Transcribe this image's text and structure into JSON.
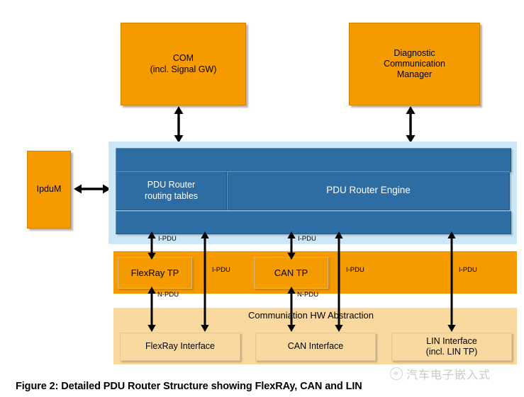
{
  "figure": {
    "caption": "Figure 2: Detailed PDU Router Structure showing FlexRAy, CAN and LIN"
  },
  "watermark": {
    "text": "汽车电子嵌入式",
    "logo_icon": "paw-logo-icon"
  },
  "upper_modules": [
    {
      "id": "com",
      "label": "COM\n(incl. Signal GW)"
    },
    {
      "id": "dcm",
      "label": "Diagnostic\nCommunication\nManager"
    }
  ],
  "side_module": {
    "id": "ipdum",
    "label": "IpduM"
  },
  "router_layer": {
    "engine_label": "PDU Router Engine",
    "routing_tables_label": "PDU Router\nrouting tables",
    "band_color": "#CCE8F8",
    "bar_color": "#2E6DA4"
  },
  "tp_layer": {
    "band_color": "#F59B00",
    "modules": [
      {
        "id": "flexray-tp",
        "label": "FlexRay TP"
      },
      {
        "id": "can-tp",
        "label": "CAN TP"
      }
    ]
  },
  "hw_layer": {
    "title": "Communiation HW Abstraction",
    "band_color": "#FAD9A0",
    "modules": [
      {
        "id": "flexray-interface",
        "label": "FlexRay Interface"
      },
      {
        "id": "can-interface",
        "label": "CAN Interface"
      },
      {
        "id": "lin-interface",
        "label": "LIN Interface\n(incl. LIN TP)"
      }
    ]
  },
  "connections": {
    "com_to_router": {
      "label": "",
      "type": "bidirectional"
    },
    "dcm_to_router": {
      "label": "",
      "type": "bidirectional"
    },
    "ipdum_to_router": {
      "label": "",
      "type": "bidirectional"
    },
    "labels": {
      "ipdu": "I-PDU",
      "npdu": "N-PDU"
    },
    "edge_labels": [
      {
        "id": "ipdu-flexray-tp",
        "text": "I-PDU"
      },
      {
        "id": "ipdu-flexray-if",
        "text": "I-PDU"
      },
      {
        "id": "ipdu-can-tp",
        "text": "I-PDU"
      },
      {
        "id": "ipdu-can-if",
        "text": "I-PDU"
      },
      {
        "id": "ipdu-lin-if",
        "text": "I-PDU"
      },
      {
        "id": "npdu-flexray",
        "text": "N-PDU"
      },
      {
        "id": "npdu-can",
        "text": "N-PDU"
      }
    ]
  }
}
